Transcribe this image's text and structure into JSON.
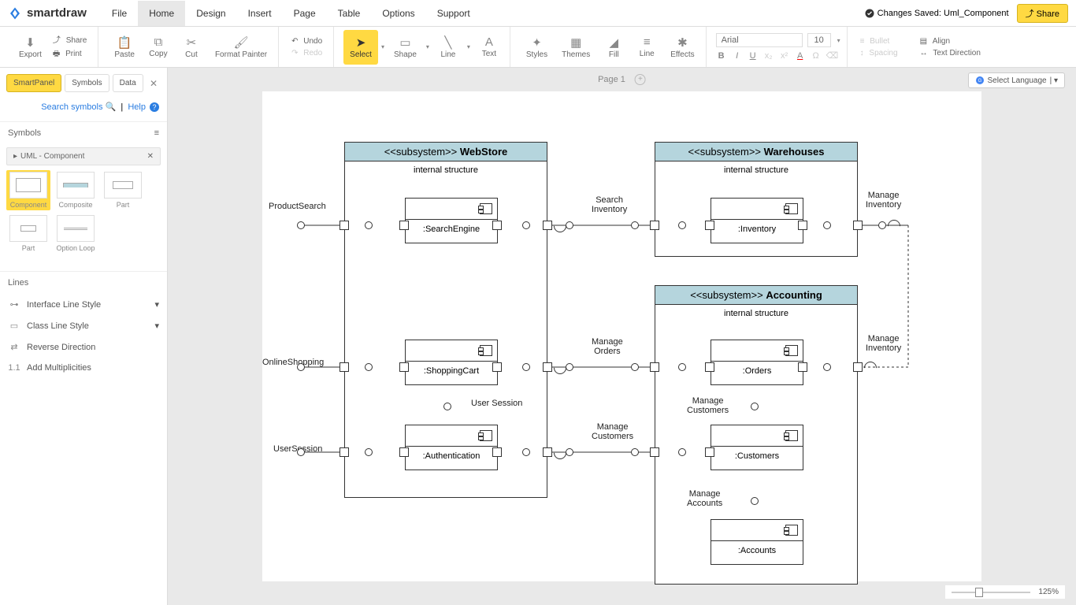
{
  "app": {
    "name": "smartdraw"
  },
  "menu": {
    "items": [
      "File",
      "Home",
      "Design",
      "Insert",
      "Page",
      "Table",
      "Options",
      "Support"
    ],
    "active": 1
  },
  "status": {
    "text": "Changes Saved: Uml_Component",
    "share": "Share"
  },
  "ribbon": {
    "export": "Export",
    "share": "Share",
    "print": "Print",
    "paste": "Paste",
    "copy": "Copy",
    "cut": "Cut",
    "format_painter": "Format Painter",
    "undo": "Undo",
    "redo": "Redo",
    "select": "Select",
    "shape": "Shape",
    "line": "Line",
    "text": "Text",
    "styles": "Styles",
    "themes": "Themes",
    "fill": "Fill",
    "line2": "Line",
    "effects": "Effects",
    "font": "Arial",
    "font_size": "10",
    "bullet": "Bullet",
    "spacing": "Spacing",
    "align": "Align",
    "text_direction": "Text Direction"
  },
  "pages": {
    "current": "Page 1"
  },
  "lang_select": "Select Language",
  "sidebar": {
    "tabs": [
      "SmartPanel",
      "Symbols",
      "Data"
    ],
    "search": "Search symbols",
    "help": "Help",
    "symbols_header": "Symbols",
    "category": "UML - Component",
    "shapes": [
      "Component",
      "Composite",
      "Part",
      "Part",
      "Option Loop"
    ],
    "lines_header": "Lines",
    "lines_items": [
      "Interface Line Style",
      "Class Line Style",
      "Reverse Direction",
      "Add Multiplicities"
    ]
  },
  "diagram": {
    "webstore": {
      "title_prefix": "<<subsystem>>",
      "title": "WebStore",
      "internal": "internal structure",
      "components": {
        "search_engine": ":SearchEngine",
        "shopping_cart": ":ShoppingCart",
        "authentication": ":Authentication"
      },
      "intf_labels": {
        "product_search": "ProductSearch",
        "online_shopping": "OnlineShopping",
        "user_session_ext": "UserSession",
        "user_session_int": "User Session"
      }
    },
    "warehouses": {
      "title_prefix": "<<subsystem>>",
      "title": "Warehouses",
      "internal": "internal structure",
      "components": {
        "inventory": ":Inventory"
      }
    },
    "accounting": {
      "title_prefix": "<<subsystem>>",
      "title": "Accounting",
      "internal": "internal structure",
      "components": {
        "orders": ":Orders",
        "customers": ":Customers",
        "accounts": ":Accounts"
      },
      "intf_labels": {
        "manage_customers_int": "Manage\nCustomers",
        "manage_accounts": "Manage\nAccounts"
      }
    },
    "connectors": {
      "search_inventory": "Search\nInventory",
      "manage_orders": "Manage\nOrders",
      "manage_customers": "Manage\nCustomers",
      "manage_inventory1": "Manage\nInventory",
      "manage_inventory2": "Manage\nInventory"
    }
  },
  "zoom": "125%"
}
